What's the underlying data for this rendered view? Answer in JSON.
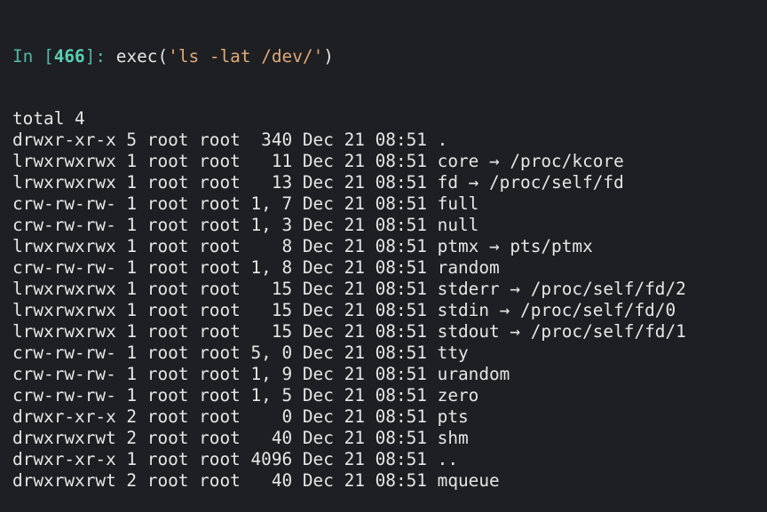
{
  "prompt": {
    "in_label": "In [",
    "cell_number": "466",
    "close": "]: ",
    "code_prefix": "exec(",
    "code_string": "'ls -lat /dev/'",
    "code_suffix": ")"
  },
  "output_lines": [
    "total 4",
    "drwxr-xr-x 5 root root  340 Dec 21 08:51 .",
    "lrwxrwxrwx 1 root root   11 Dec 21 08:51 core → /proc/kcore",
    "lrwxrwxrwx 1 root root   13 Dec 21 08:51 fd → /proc/self/fd",
    "crw-rw-rw- 1 root root 1, 7 Dec 21 08:51 full",
    "crw-rw-rw- 1 root root 1, 3 Dec 21 08:51 null",
    "lrwxrwxrwx 1 root root    8 Dec 21 08:51 ptmx → pts/ptmx",
    "crw-rw-rw- 1 root root 1, 8 Dec 21 08:51 random",
    "lrwxrwxrwx 1 root root   15 Dec 21 08:51 stderr → /proc/self/fd/2",
    "lrwxrwxrwx 1 root root   15 Dec 21 08:51 stdin → /proc/self/fd/0",
    "lrwxrwxrwx 1 root root   15 Dec 21 08:51 stdout → /proc/self/fd/1",
    "crw-rw-rw- 1 root root 5, 0 Dec 21 08:51 tty",
    "crw-rw-rw- 1 root root 1, 9 Dec 21 08:51 urandom",
    "crw-rw-rw- 1 root root 1, 5 Dec 21 08:51 zero",
    "drwxr-xr-x 2 root root    0 Dec 21 08:51 pts",
    "drwxrwxrwt 2 root root   40 Dec 21 08:51 shm",
    "drwxr-xr-x 1 root root 4096 Dec 21 08:51 ..",
    "drwxrwxrwt 2 root root   40 Dec 21 08:51 mqueue"
  ],
  "colors": {
    "background": "#1e1f22",
    "text": "#e6e6e6",
    "prompt": "#4fb8a5",
    "prompt_number": "#58d0b6",
    "string": "#e0a97a"
  }
}
